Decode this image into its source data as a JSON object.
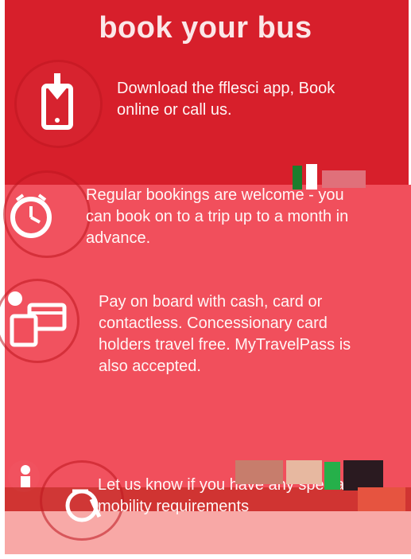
{
  "header": {
    "title": "book your bus"
  },
  "features": [
    {
      "icon": "phone-download-icon",
      "text": "Download the fflesci app, Book online or call us."
    },
    {
      "icon": "clock-icon",
      "text": "Regular bookings are welcome - you can book on to a trip up to a month in advance."
    },
    {
      "icon": "card-payment-icon",
      "text": "Pay on board with cash, card or contactless. Concessionary card holders travel free. MyTravelPass is also accepted."
    },
    {
      "icon": "wheelchair-icon",
      "text": "Let us know if you have any special mobility requirements"
    }
  ],
  "colors": {
    "top_band": "#d71f2b",
    "mid_band": "#f14f5c",
    "strip": "#d03432",
    "bottom_band": "#f8a8a6"
  }
}
